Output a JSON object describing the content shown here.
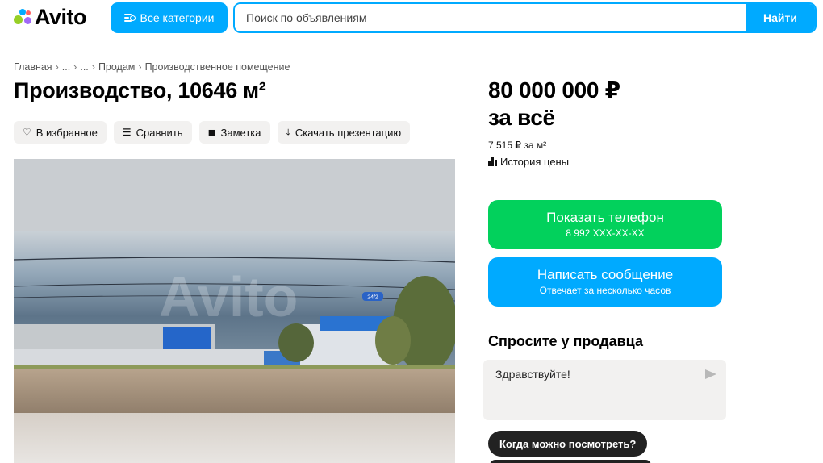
{
  "header": {
    "logo_text": "Avito",
    "categories_label": "Все категории",
    "search_placeholder": "Поиск по объявлениям",
    "search_button": "Найти"
  },
  "breadcrumb": [
    "Главная",
    "...",
    "...",
    "Продам",
    "Производственное помещение"
  ],
  "listing": {
    "title": "Производство, 10646 м²",
    "price_line1": "80 000 000 ₽",
    "price_line2": "за всё",
    "price_per_m2": "7 515 ₽ за м²",
    "price_history": "История цены"
  },
  "actions": [
    {
      "label": "В избранное",
      "icon": "heart-icon"
    },
    {
      "label": "Сравнить",
      "icon": "compare-icon"
    },
    {
      "label": "Заметка",
      "icon": "note-icon"
    },
    {
      "label": "Скачать презентацию",
      "icon": "download-icon"
    }
  ],
  "contact": {
    "phone_label": "Показать телефон",
    "phone_number": "8 992 XXX-XX-XX",
    "message_label": "Написать сообщение",
    "message_sub": "Отвечает за несколько часов"
  },
  "ask": {
    "title": "Спросите у продавца",
    "input_value": "Здравствуйте!",
    "chips": [
      "Когда можно посмотреть?"
    ]
  },
  "photo": {
    "watermark": "Avito",
    "sign_text": "24/2"
  },
  "colors": {
    "accent": "#00aaff",
    "phone_green": "#02d15c",
    "chip_dark": "#222222"
  }
}
